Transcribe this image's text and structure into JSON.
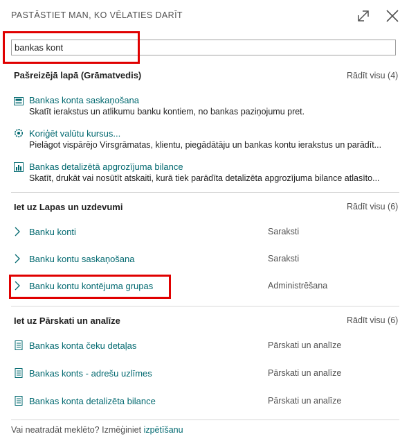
{
  "header": {
    "title": "PASTĀSTIET MAN, KO VĒLATIES DARĪT",
    "expand_icon": "expand-icon",
    "close_icon": "close-icon"
  },
  "search": {
    "value": "bankas kont"
  },
  "sections": {
    "current_page": {
      "title": "Pašreizējā lapā (Grāmatvedis)",
      "show_all": "Rādīt visu (4)",
      "items": [
        {
          "label": "Bankas konta saskaņošana",
          "description": "Skatīt ierakstus un atlikumu banku kontiem, no bankas paziņojumu pret.",
          "icon": "reconcile-icon"
        },
        {
          "label": "Koriģēt valūtu kursus...",
          "description": "Pielāgot vispārējo Virsgrāmatas, klientu, piegādātāju un bankas kontu ierakstus un parādīt...",
          "icon": "currency-gear-icon"
        },
        {
          "label": "Bankas detalizētā apgrozījuma bilance",
          "description": "Skatīt, drukāt vai nosūtīt atskaiti, kurā tiek parādīta detalizēta apgrozījuma bilance atlasīto...",
          "icon": "report-chart-icon"
        }
      ]
    },
    "pages_tasks": {
      "title": "Iet uz Lapas un uzdevumi",
      "show_all": "Rādīt visu (6)",
      "items": [
        {
          "label": "Banku konti",
          "category": "Saraksti"
        },
        {
          "label": "Banku kontu saskaņošana",
          "category": "Saraksti"
        },
        {
          "label": "Banku kontu kontējuma grupas",
          "category": "Administrēšana"
        }
      ]
    },
    "reports": {
      "title": "Iet uz Pārskati un analīze",
      "show_all": "Rādīt visu (6)",
      "items": [
        {
          "label": "Bankas konta čeku detaļas",
          "category": "Pārskati un analīze"
        },
        {
          "label": "Bankas konts - adrešu uzlīmes",
          "category": "Pārskati un analīze"
        },
        {
          "label": "Bankas konta detalizēta bilance",
          "category": "Pārskati un analīze"
        }
      ]
    }
  },
  "footer": {
    "text": "Vai neatradāt meklēto? Izmēģiniet",
    "link": "izpētīšanu"
  },
  "highlight_color": "#e00000",
  "link_color": "#00686f"
}
